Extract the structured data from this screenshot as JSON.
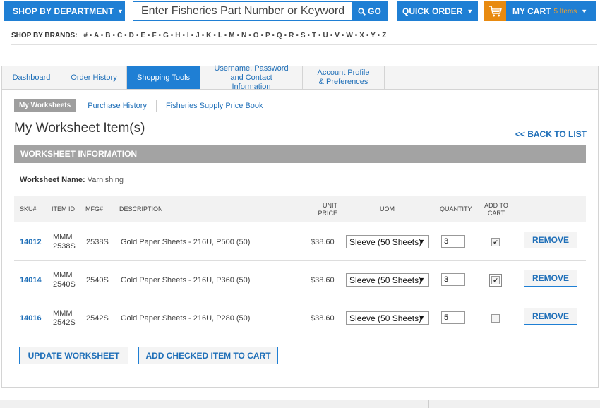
{
  "header": {
    "department_label": "SHOP BY DEPARTMENT",
    "search_placeholder": "Enter Fisheries Part Number or Keyword",
    "search_go_label": "GO",
    "quick_order_label": "QUICK ORDER",
    "cart_label": "MY CART",
    "cart_count": "5 Items"
  },
  "brands": {
    "label": "SHOP BY BRANDS:",
    "letters": "# • A • B • C • D • E • F • G • H • I • J • K • L • M • N • O • P • Q • R • S • T • U • V • W • X • Y • Z"
  },
  "nav": {
    "tabs": [
      {
        "label": "Dashboard"
      },
      {
        "label": "Order History"
      },
      {
        "label": "Shopping Tools"
      },
      {
        "label": "Username, Password and Contact Information"
      },
      {
        "label": "Account Profile & Preferences"
      }
    ]
  },
  "subnav": {
    "items": [
      {
        "label": "My Worksheets"
      },
      {
        "label": "Purchase History"
      },
      {
        "label": "Fisheries Supply Price Book"
      }
    ]
  },
  "page": {
    "title": "My Worksheet Item(s)",
    "back_link": "<< BACK TO LIST",
    "info_header": "WORKSHEET INFORMATION",
    "worksheet_name_label": "Worksheet Name:",
    "worksheet_name": "Varnishing"
  },
  "table": {
    "headers": {
      "sku": "SKU#",
      "item_id": "ITEM ID",
      "mfg": "MFG#",
      "description": "DESCRIPTION",
      "unit_price_1": "UNIT",
      "unit_price_2": "PRICE",
      "uom": "UOM",
      "quantity": "QUANTITY",
      "add_to_cart_1": "ADD TO",
      "add_to_cart_2": "CART"
    },
    "rows": [
      {
        "sku": "14012",
        "item_id_1": "MMM",
        "item_id_2": "2538S",
        "mfg": "2538S",
        "description": "Gold Paper Sheets - 216U, P500 (50)",
        "price": "$38.60",
        "uom": "Sleeve (50 Sheets)",
        "quantity": "3",
        "checked": "✔",
        "remove": "REMOVE"
      },
      {
        "sku": "14014",
        "item_id_1": "MMM",
        "item_id_2": "2540S",
        "mfg": "2540S",
        "description": "Gold Paper Sheets - 216U, P360 (50)",
        "price": "$38.60",
        "uom": "Sleeve (50 Sheets)",
        "quantity": "3",
        "checked": "✔",
        "remove": "REMOVE"
      },
      {
        "sku": "14016",
        "item_id_1": "MMM",
        "item_id_2": "2542S",
        "mfg": "2542S",
        "description": "Gold Paper Sheets - 216U, P280 (50)",
        "price": "$38.60",
        "uom": "Sleeve (50 Sheets)",
        "quantity": "5",
        "checked": "",
        "remove": "REMOVE"
      }
    ]
  },
  "actions": {
    "update": "UPDATE WORKSHEET",
    "add_checked": "ADD CHECKED ITEM TO CART"
  },
  "icons": {
    "caret": "▼",
    "search": "search-icon",
    "cart": "cart-icon"
  },
  "colors": {
    "primary": "#1f7fd4",
    "cart_accent": "#e88a10",
    "info_bar": "#a3a3a3"
  }
}
